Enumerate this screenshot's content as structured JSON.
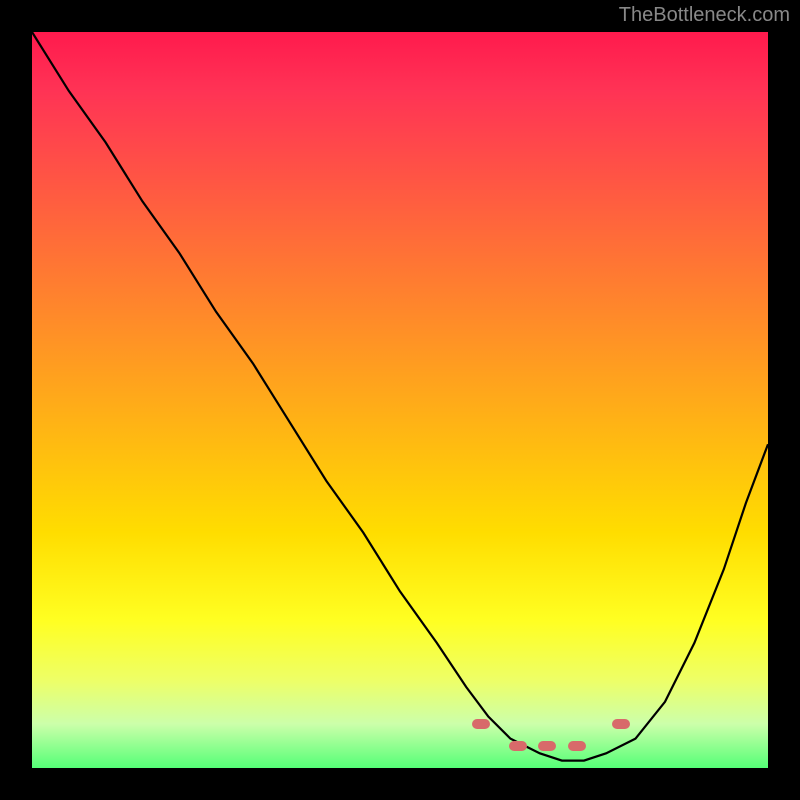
{
  "attribution": "TheBottleneck.com",
  "chart_data": {
    "type": "line",
    "title": "",
    "xlabel": "",
    "ylabel": "",
    "xlim": [
      0,
      100
    ],
    "ylim": [
      0,
      100
    ],
    "background": "gradient-red-to-green",
    "series": [
      {
        "name": "bottleneck-curve",
        "x": [
          0,
          5,
          10,
          15,
          20,
          25,
          30,
          35,
          40,
          45,
          50,
          55,
          59,
          62,
          65,
          69,
          72,
          75,
          78,
          82,
          86,
          90,
          94,
          97,
          100
        ],
        "values": [
          100,
          92,
          85,
          77,
          70,
          62,
          55,
          47,
          39,
          32,
          24,
          17,
          11,
          7,
          4,
          2,
          1,
          1,
          2,
          4,
          9,
          17,
          27,
          36,
          44
        ]
      }
    ],
    "markers": [
      {
        "name": "left-marker",
        "x": 61,
        "y": 6
      },
      {
        "name": "center-marker-1",
        "x": 66,
        "y": 3
      },
      {
        "name": "center-marker-2",
        "x": 70,
        "y": 3
      },
      {
        "name": "center-marker-3",
        "x": 74,
        "y": 3
      },
      {
        "name": "right-marker",
        "x": 80,
        "y": 6
      }
    ]
  }
}
